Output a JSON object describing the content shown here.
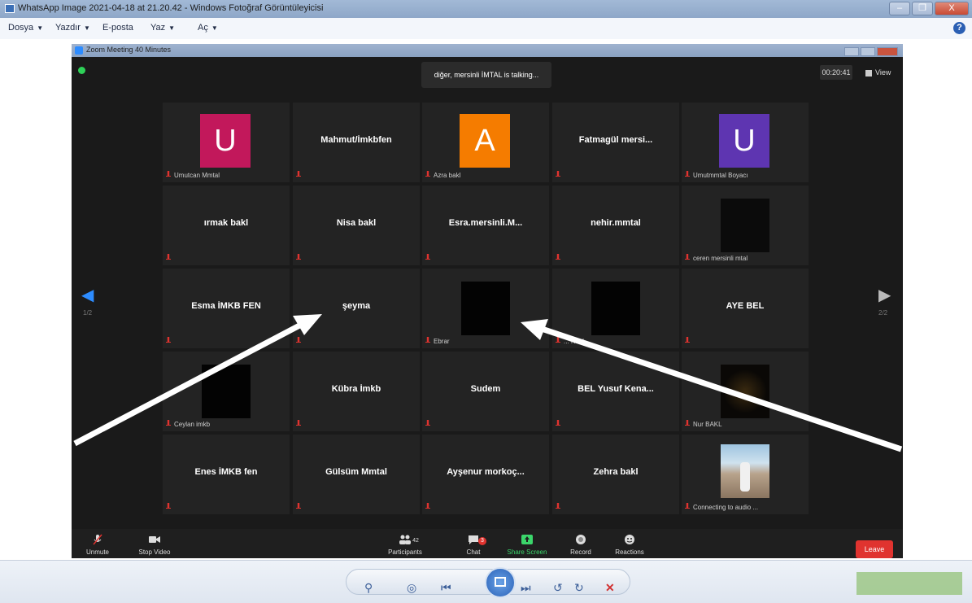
{
  "viewer": {
    "title": "WhatsApp Image 2021-04-18 at 21.20.42 - Windows Fotoğraf Görüntüleyicisi",
    "menu": [
      "Dosya",
      "Yazdır",
      "E-posta",
      "Yaz",
      "Aç"
    ],
    "window_controls": [
      "–",
      "❐",
      "X"
    ],
    "help_label": "?"
  },
  "zoom": {
    "title": "Zoom Meeting 40 Minutes",
    "talking": "diğer, mersinli İMTAL is talking...",
    "timer": "00:20:41",
    "view_label": "View",
    "page_left": "1/2",
    "page_right": "2/2",
    "tiles": [
      {
        "row": 0,
        "col": 0,
        "name": "",
        "label": "Umutcan Mmtal",
        "avatar": "U",
        "avatar_color": "#c2185b"
      },
      {
        "row": 0,
        "col": 1,
        "name": "Mahmut/İmkbfen",
        "label": ""
      },
      {
        "row": 0,
        "col": 2,
        "name": "",
        "label": "Azra bakl",
        "avatar": "A",
        "avatar_color": "#f57c00"
      },
      {
        "row": 0,
        "col": 3,
        "name": "Fatmagül mersi...",
        "label": ""
      },
      {
        "row": 0,
        "col": 4,
        "name": "",
        "label": "Umutmmtal Boyacı",
        "avatar": "U",
        "avatar_color": "#5e35b1"
      },
      {
        "row": 1,
        "col": 0,
        "name": "ırmak bakl",
        "label": ""
      },
      {
        "row": 1,
        "col": 1,
        "name": "Nisa bakl",
        "label": ""
      },
      {
        "row": 1,
        "col": 2,
        "name": "Esra.mersinli.M...",
        "label": ""
      },
      {
        "row": 1,
        "col": 3,
        "name": "nehir.mmtal",
        "label": ""
      },
      {
        "row": 1,
        "col": 4,
        "name": "",
        "label": "ceren mersinli mtal",
        "video": "dim"
      },
      {
        "row": 2,
        "col": 0,
        "name": "Esma İMKB FEN",
        "label": ""
      },
      {
        "row": 2,
        "col": 1,
        "name": "şeyma",
        "label": ""
      },
      {
        "row": 2,
        "col": 2,
        "name": "",
        "label": "Ebrar",
        "video": "black"
      },
      {
        "row": 2,
        "col": 3,
        "name": "",
        "label": "... Kübl",
        "video": "black"
      },
      {
        "row": 2,
        "col": 4,
        "name": "AYE BEL",
        "label": ""
      },
      {
        "row": 3,
        "col": 0,
        "name": "",
        "label": "Ceylan imkb",
        "video": "black"
      },
      {
        "row": 3,
        "col": 1,
        "name": "Kübra İmkb",
        "label": ""
      },
      {
        "row": 3,
        "col": 2,
        "name": "Sudem",
        "label": ""
      },
      {
        "row": 3,
        "col": 3,
        "name": "BEL Yusuf Kena...",
        "label": ""
      },
      {
        "row": 3,
        "col": 4,
        "name": "",
        "label": "Nur BAKL",
        "video": "candle"
      },
      {
        "row": 4,
        "col": 0,
        "name": "Enes İMKB fen",
        "label": ""
      },
      {
        "row": 4,
        "col": 1,
        "name": "Gülsüm Mmtal",
        "label": ""
      },
      {
        "row": 4,
        "col": 2,
        "name": "Ayşenur morkoç...",
        "label": ""
      },
      {
        "row": 4,
        "col": 3,
        "name": "Zehra bakl",
        "label": ""
      },
      {
        "row": 4,
        "col": 4,
        "name": "",
        "label": "Connecting to audio ...",
        "video": "photo"
      }
    ],
    "controls": {
      "unmute": "Unmute",
      "stop_video": "Stop Video",
      "participants": "Participants",
      "participants_count": "42",
      "chat": "Chat",
      "chat_badge": "3",
      "share_screen": "Share Screen",
      "record": "Record",
      "reactions": "Reactions",
      "leave": "Leave"
    }
  },
  "colors": {
    "zoom_bg": "#1a1a1a",
    "tile_bg": "#232323",
    "leave_red": "#e0332f",
    "share_green": "#3bd66b",
    "arrow_white": "#ffffff"
  }
}
